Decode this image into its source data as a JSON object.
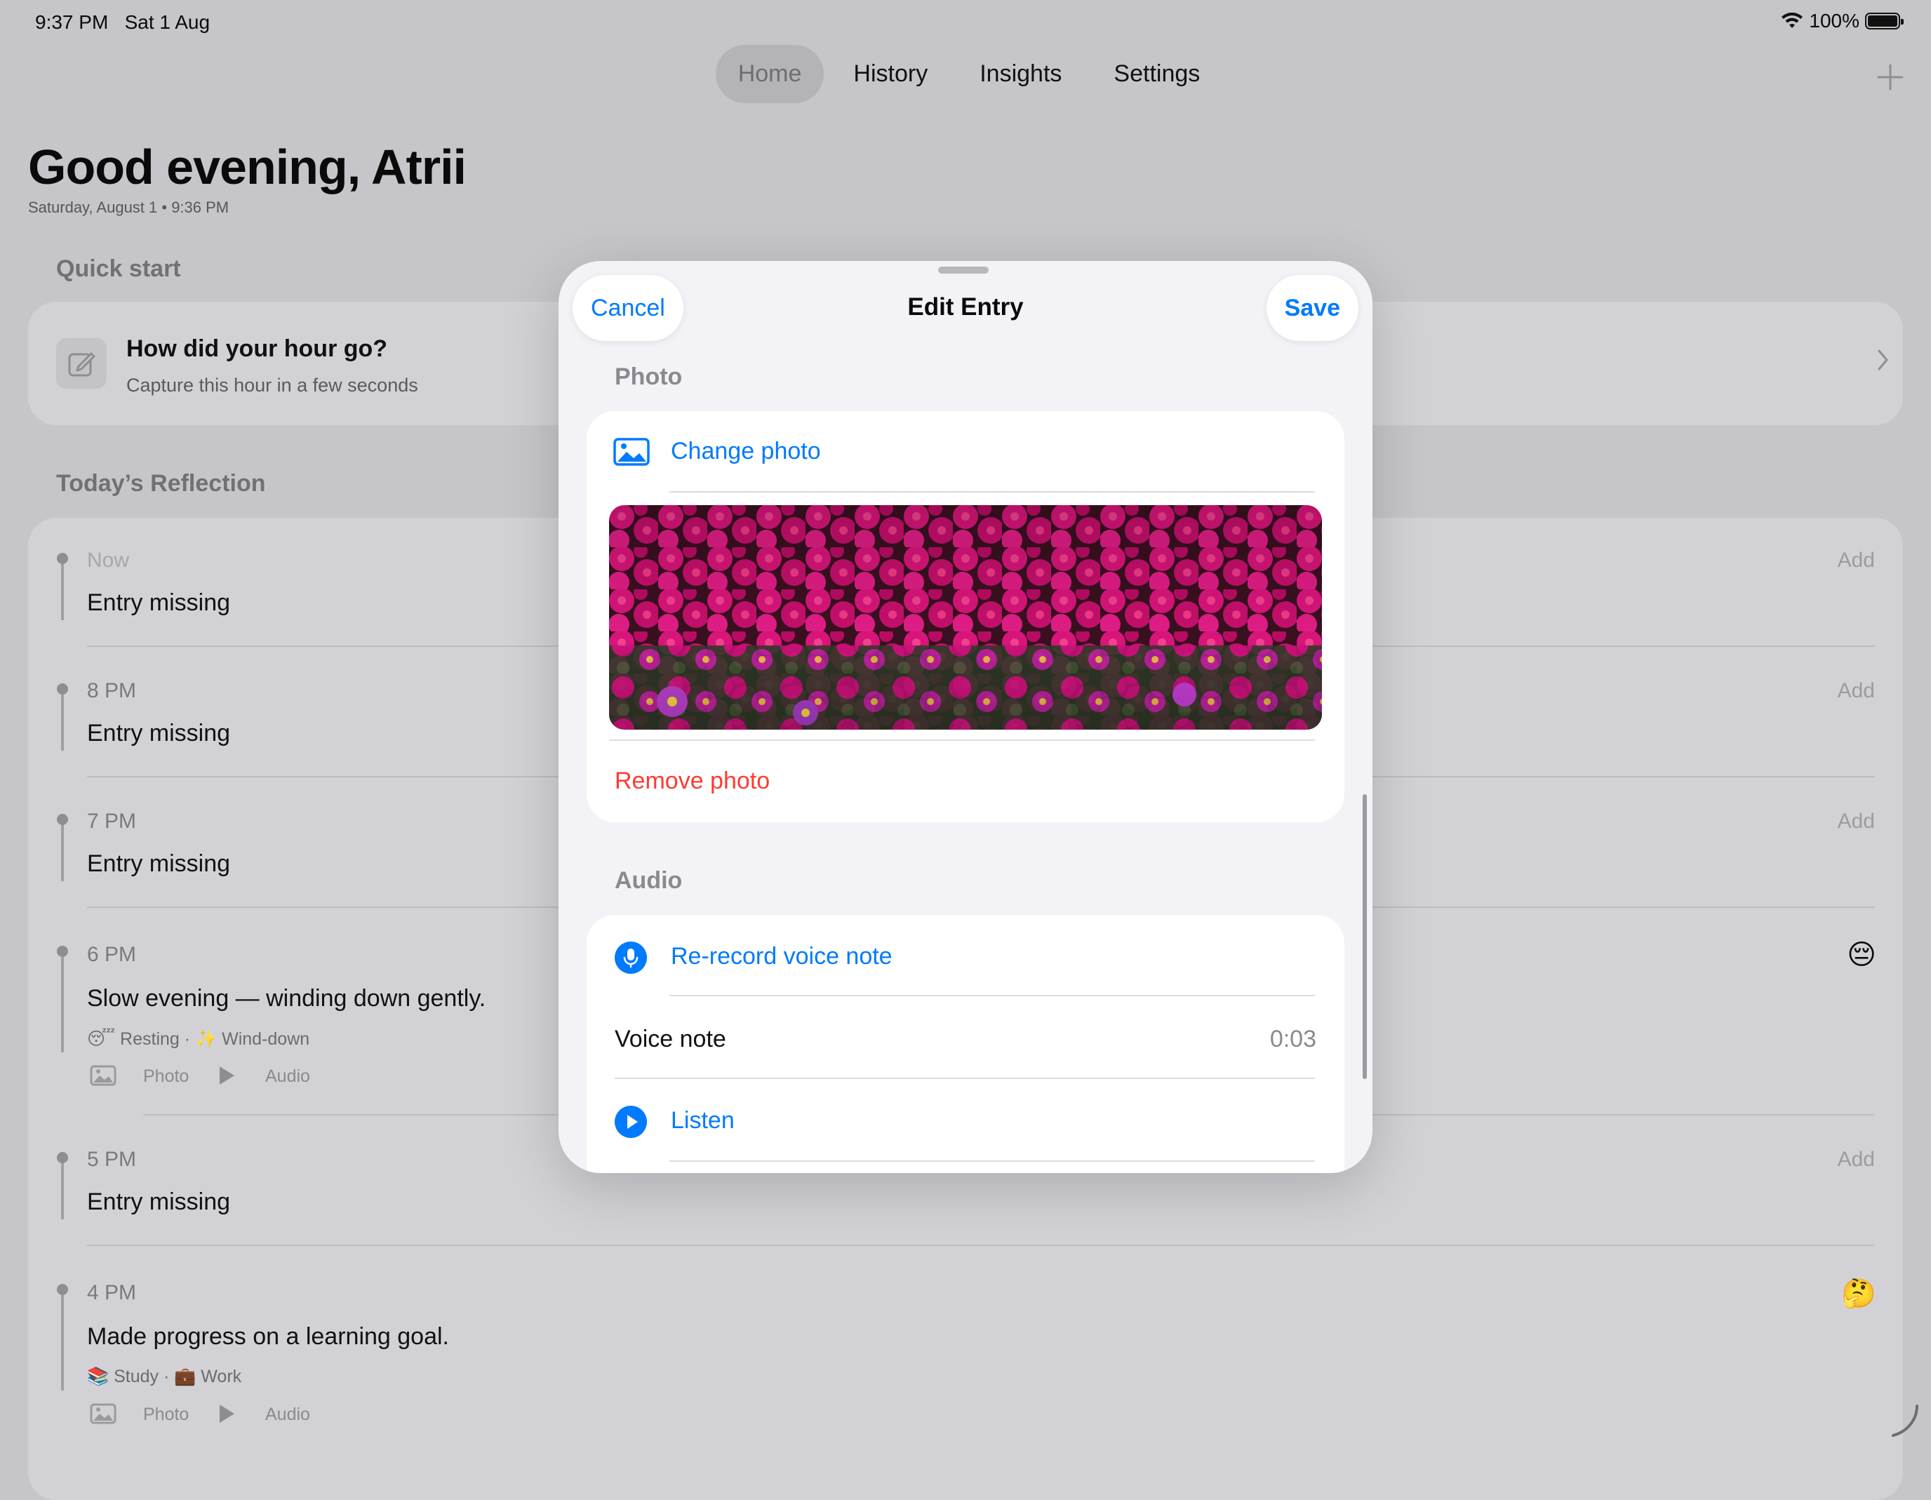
{
  "status_bar": {
    "time": "9:37 PM",
    "date": "Sat 1 Aug",
    "battery": "100%"
  },
  "tabs": [
    {
      "label": "Home",
      "active": true
    },
    {
      "label": "History",
      "active": false
    },
    {
      "label": "Insights",
      "active": false
    },
    {
      "label": "Settings",
      "active": false
    }
  ],
  "add_icon": "plus-icon",
  "greeting": {
    "title": "Good evening, Atrii",
    "subtitle": "Saturday, August 1 • 9:36 PM"
  },
  "quick_start": {
    "section_title": "Quick start",
    "title": "How did your hour go?",
    "subtitle": "Capture this hour in a few seconds"
  },
  "reflection": {
    "section_title": "Today’s Reflection",
    "add_label": "Add",
    "entries": [
      {
        "time": "Now",
        "text": "Entry missing"
      },
      {
        "time": "8 PM",
        "text": "Entry missing"
      },
      {
        "time": "7 PM",
        "text": "Entry missing"
      },
      {
        "time": "6 PM",
        "text": "Slow evening — winding down gently.",
        "tags": "😴 Resting · ✨ Wind-down",
        "photo": "Photo",
        "audio": "Audio",
        "emoji": "😔"
      },
      {
        "time": "5 PM",
        "text": "Entry missing"
      },
      {
        "time": "4 PM",
        "text": "Made progress on a learning goal.",
        "tags": "📚 Study · 💼 Work",
        "photo": "Photo",
        "audio": "Audio",
        "emoji": "🤔"
      }
    ]
  },
  "modal": {
    "title": "Edit Entry",
    "cancel": "Cancel",
    "save": "Save",
    "photo_section": "Photo",
    "change_photo": "Change photo",
    "remove_photo": "Remove photo",
    "audio_section": "Audio",
    "rerecord": "Re-record voice note",
    "voice_note_label": "Voice note",
    "voice_note_duration": "0:03",
    "listen": "Listen"
  },
  "colors": {
    "accent": "#007aff",
    "destructive": "#ff3b30",
    "flower": "#d8157a"
  }
}
